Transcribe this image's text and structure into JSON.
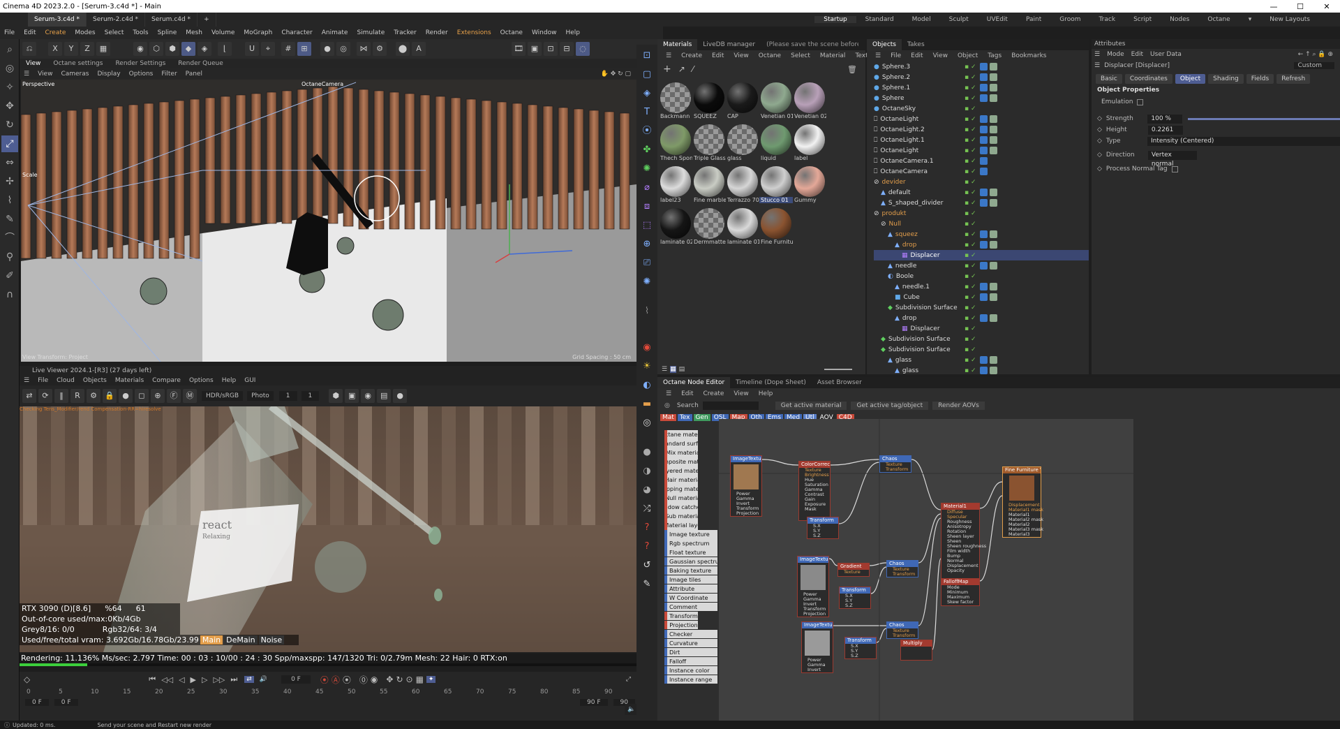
{
  "app": {
    "window_title": "Cinema 4D 2023.2.0 - [Serum-3.c4d *] - Main",
    "file_tabs": [
      "Serum-3.c4d *",
      "Serum-2.c4d *",
      "Serum.c4d *"
    ],
    "layouts": [
      "Startup",
      "Standard",
      "Model",
      "Sculpt",
      "UVEdit",
      "Paint",
      "Groom",
      "Track",
      "Script",
      "Nodes",
      "Octane"
    ],
    "new_layouts": "New Layouts"
  },
  "menu": [
    "File",
    "Edit",
    "Create",
    "Modes",
    "Select",
    "Tools",
    "Spline",
    "Mesh",
    "Volume",
    "MoGraph",
    "Character",
    "Animate",
    "Simulate",
    "Tracker",
    "Render",
    "Extensions",
    "Octane",
    "Window",
    "Help"
  ],
  "toolbar": {
    "axes": [
      "X",
      "Y",
      "Z"
    ]
  },
  "viewport": {
    "tabs": [
      "View",
      "Octane settings",
      "Render Settings",
      "Render Queue"
    ],
    "menu": [
      "View",
      "Cameras",
      "Display",
      "Options",
      "Filter",
      "Panel"
    ],
    "perspective": "Perspective",
    "camera": "OctaneCamera",
    "scale_label": "Scale",
    "view_transform": "View Transform: Project",
    "grid_spacing": "Grid Spacing : 50 cm"
  },
  "live_viewer": {
    "title": "Live Viewer 2024.1-[R3] (27 days left)",
    "menu": [
      "File",
      "Cloud",
      "Objects",
      "Materials",
      "Compare",
      "Options",
      "Help",
      "GUI"
    ],
    "color_space": "HDR/sRGB",
    "mode": "Photo",
    "val1": "1",
    "val2": "1",
    "overlay": "Checking Tens_Modifier/rend Compensation-RR=hiresolve",
    "label_text": "react",
    "label_sub": "Relaxing",
    "stats": {
      "gpu": "RTX 3090 (D)[8.6]",
      "pct": "%64",
      "temp": "61",
      "ooc": "Out-of-core used/max:0Kb/4Gb",
      "grey": "Grey8/16: 0/0",
      "rgb": "Rgb32/64: 3/4",
      "vram": "Used/free/total vram: 3.692Gb/16.78Gb/23.99",
      "tabs": [
        "Main",
        "DeMain",
        "Noise"
      ],
      "rendering": "Rendering: 11.136%  Ms/sec: 2.797  Time: 00 : 03 : 10/00 : 24 : 30  Spp/maxspp: 147/1320  Tri: 0/2.79m  Mesh: 22  Hair: 0  RTX:on"
    },
    "progress": 0.11
  },
  "timeline": {
    "frame_display": "0 F",
    "ticks": [
      "0",
      "5",
      "10",
      "15",
      "20",
      "25",
      "30",
      "35",
      "40",
      "45",
      "50",
      "55",
      "60",
      "65",
      "70",
      "75",
      "80",
      "85",
      "90"
    ],
    "start": "0 F",
    "start2": "0 F",
    "end": "90 F",
    "end2": "90",
    "slider_value": "10"
  },
  "status": {
    "updated": "Updated: 0 ms.",
    "message": "Send your scene and Restart new render"
  },
  "materials": {
    "tabs": [
      "Materials",
      "LiveDB manager"
    ],
    "notice": "(Please save the scene before downloading",
    "menu": [
      "Create",
      "Edit",
      "View",
      "Octane",
      "Select",
      "Material",
      "Texture"
    ],
    "items": [
      {
        "name": "Backmann",
        "color": "checker"
      },
      {
        "name": "SQUEEZ",
        "color": "#0b0b0b"
      },
      {
        "name": "CAP",
        "color": "#1a1a1a"
      },
      {
        "name": "Venetian 01",
        "color": "#8fa98f"
      },
      {
        "name": "Venetian 02",
        "color": "#b8a0b8"
      },
      {
        "name": "Thech Spon",
        "color": "#7f9a68"
      },
      {
        "name": "Triple Glass",
        "color": "checker"
      },
      {
        "name": "glass",
        "color": "checker"
      },
      {
        "name": "liquid",
        "color": "#6f9a70"
      },
      {
        "name": "label",
        "color": "#f2f2f2"
      },
      {
        "name": "label23",
        "color": "#dcdcdc"
      },
      {
        "name": "Fine marble",
        "color": "#c9ccc4"
      },
      {
        "name": "Terrazzo 70",
        "color": "#d6d6d6"
      },
      {
        "name": "Stucco 01",
        "color": "#cfcfcf"
      },
      {
        "name": "Gummy",
        "color": "#e4a898"
      },
      {
        "name": "laminate 02",
        "color": "#151515"
      },
      {
        "name": "Dermmatte",
        "color": "checker"
      },
      {
        "name": "laminate 01",
        "color": "#d9d9d9"
      },
      {
        "name": "Fine Furniture",
        "color": "#8a5330"
      }
    ],
    "selected": "Stucco 01"
  },
  "objects": {
    "tabs": [
      "Objects",
      "Takes"
    ],
    "menu": [
      "File",
      "Edit",
      "View",
      "Object",
      "Tags",
      "Bookmarks"
    ],
    "rows": [
      {
        "name": "Sphere.3",
        "depth": 0,
        "type": "sphere"
      },
      {
        "name": "Sphere.2",
        "depth": 0,
        "type": "sphere"
      },
      {
        "name": "Sphere.1",
        "depth": 0,
        "type": "sphere"
      },
      {
        "name": "Sphere",
        "depth": 0,
        "type": "sphere"
      },
      {
        "name": "OctaneSky",
        "depth": 0,
        "type": "sky"
      },
      {
        "name": "OctaneLight",
        "depth": 0,
        "type": "light"
      },
      {
        "name": "OctaneLight.2",
        "depth": 0,
        "type": "light"
      },
      {
        "name": "OctaneLight.1",
        "depth": 0,
        "type": "light"
      },
      {
        "name": "OctaneLight",
        "depth": 0,
        "type": "light"
      },
      {
        "name": "OctaneCamera.1",
        "depth": 0,
        "type": "camera"
      },
      {
        "name": "OctaneCamera",
        "depth": 0,
        "type": "camera"
      },
      {
        "name": "devider",
        "depth": 0,
        "type": "null",
        "orange": true
      },
      {
        "name": "default",
        "depth": 1,
        "type": "poly"
      },
      {
        "name": "S_shaped_divider",
        "depth": 1,
        "type": "poly"
      },
      {
        "name": "produkt",
        "depth": 0,
        "type": "null",
        "orange": true
      },
      {
        "name": "Null",
        "depth": 1,
        "type": "null",
        "orange": true
      },
      {
        "name": "squeez",
        "depth": 2,
        "type": "poly",
        "orange": true
      },
      {
        "name": "drop",
        "depth": 3,
        "type": "poly",
        "orange": true
      },
      {
        "name": "Displacer",
        "depth": 4,
        "type": "deformer",
        "selected": true
      },
      {
        "name": "needle",
        "depth": 2,
        "type": "poly"
      },
      {
        "name": "Boole",
        "depth": 2,
        "type": "boole"
      },
      {
        "name": "needle.1",
        "depth": 3,
        "type": "poly"
      },
      {
        "name": "Cube",
        "depth": 3,
        "type": "cube"
      },
      {
        "name": "Subdivision Surface",
        "depth": 2,
        "type": "subd"
      },
      {
        "name": "drop",
        "depth": 3,
        "type": "poly"
      },
      {
        "name": "Displacer",
        "depth": 4,
        "type": "deformer"
      },
      {
        "name": "Subdivision Surface",
        "depth": 1,
        "type": "subd"
      },
      {
        "name": "Subdivision Surface",
        "depth": 1,
        "type": "subd"
      },
      {
        "name": "glass",
        "depth": 2,
        "type": "poly"
      },
      {
        "name": "glass",
        "depth": 3,
        "type": "poly"
      }
    ]
  },
  "attributes": {
    "title": "Attributes",
    "menu": [
      "Mode",
      "Edit",
      "User Data"
    ],
    "object_name": "Displacer [Displacer]",
    "preset": "Custom",
    "tabs": [
      "Basic",
      "Coordinates",
      "Object",
      "Shading",
      "Fields",
      "Refresh"
    ],
    "section": "Object Properties",
    "fields": {
      "emulation": "Emulation",
      "strength_label": "Strength",
      "strength": "100 %",
      "height_label": "Height",
      "height": "0.2261 cm",
      "type_label": "Type",
      "type": "Intensity (Centered)",
      "direction_label": "Direction",
      "direction": "Vertex normal",
      "process_label": "Process Normal Tag"
    }
  },
  "node_editor": {
    "tabs": [
      "Octane Node Editor",
      "Timeline (Dope Sheet)",
      "Asset Browser"
    ],
    "menu": [
      "Edit",
      "Create",
      "View",
      "Help"
    ],
    "search": "Search",
    "buttons": [
      "Get active material",
      "Get active tag/object",
      "Render AOVs"
    ],
    "filters": [
      "Mat",
      "Tex",
      "Gen",
      "OSL",
      "Map",
      "Oth",
      "Ems",
      "Med",
      "Utl",
      "AOV",
      "C4D"
    ],
    "list": [
      {
        "label": "Octane material",
        "kind": "mat"
      },
      {
        "label": "Standard surface",
        "kind": "mat"
      },
      {
        "label": "Mix material",
        "kind": "mat"
      },
      {
        "label": "Composite material",
        "kind": "mat"
      },
      {
        "label": "Layered material",
        "kind": "mat"
      },
      {
        "label": "Hair material",
        "kind": "mat"
      },
      {
        "label": "Clipping material",
        "kind": "mat"
      },
      {
        "label": "Null material",
        "kind": "mat"
      },
      {
        "label": "Shadow catcher m",
        "kind": "mat"
      },
      {
        "label": "Sub material",
        "kind": "mat"
      },
      {
        "label": "Material layer",
        "kind": "mat"
      },
      {
        "label": "Image texture",
        "kind": "tex"
      },
      {
        "label": "Rgb spectrum",
        "kind": "tex"
      },
      {
        "label": "Float texture",
        "kind": "tex"
      },
      {
        "label": "Gaussian spectrum",
        "kind": "tex"
      },
      {
        "label": "Baking texture",
        "kind": "tex"
      },
      {
        "label": "Image tiles",
        "kind": "tex"
      },
      {
        "label": "Attribute",
        "kind": "tex"
      },
      {
        "label": "W Coordinate",
        "kind": "tex"
      },
      {
        "label": "Comment",
        "kind": "tex"
      },
      {
        "label": "Transform",
        "kind": "mat"
      },
      {
        "label": "Projection",
        "kind": "mat"
      },
      {
        "label": "Checker",
        "kind": "tex"
      },
      {
        "label": "Curvature",
        "kind": "tex"
      },
      {
        "label": "Dirt",
        "kind": "tex"
      },
      {
        "label": "Falloff",
        "kind": "tex"
      },
      {
        "label": "Instance color",
        "kind": "tex"
      },
      {
        "label": "Instance range",
        "kind": "tex"
      }
    ],
    "nodes": [
      {
        "id": "imgtex1",
        "title": "ImageTexture",
        "params": [
          "Power",
          "Gamma",
          "Invert",
          "Transform",
          "Projection"
        ],
        "thumb": "#a07850"
      },
      {
        "id": "colorcorr",
        "title": "ColorCorrectio",
        "params": [
          "Texture",
          "Brightness",
          "Hue",
          "Saturation",
          "Gamma",
          "Contrast",
          "Gain",
          "Exposure",
          "Mask"
        ]
      },
      {
        "id": "chaos1",
        "title": "Chaos",
        "params": [
          "Texture",
          "Transform"
        ]
      },
      {
        "id": "transform1",
        "title": "Transform",
        "params": [
          "S.X",
          "S.Y",
          "S.Z"
        ]
      },
      {
        "id": "imgtex2",
        "title": "ImageTexture",
        "params": [
          "Power",
          "Gamma",
          "Invert",
          "Transform",
          "Projection"
        ],
        "thumb": "#8a8a8a"
      },
      {
        "id": "gradient",
        "title": "Gradient",
        "params": [
          "Texture"
        ]
      },
      {
        "id": "chaos2",
        "title": "Chaos",
        "params": [
          "Texture",
          "Transform"
        ]
      },
      {
        "id": "transform2",
        "title": "Transform",
        "params": [
          "S.X",
          "S.Y",
          "S.Z"
        ]
      },
      {
        "id": "imgtex3",
        "title": "ImageTexture",
        "params": [
          "Power",
          "Gamma",
          "Invert"
        ],
        "thumb": "#9a9a9a"
      },
      {
        "id": "transform3",
        "title": "Transform",
        "params": [
          "S.X",
          "S.Y",
          "S.Z"
        ]
      },
      {
        "id": "chaos3",
        "title": "Chaos",
        "params": [
          "Texture",
          "Transform"
        ]
      },
      {
        "id": "multiply",
        "title": "Multiply",
        "params": []
      },
      {
        "id": "material1",
        "title": "Material1",
        "params": [
          "Diffuse",
          "Specular",
          "Roughness",
          "Anisotropy",
          "Rotation",
          "Sheen layer",
          "Sheen",
          "Sheen roughness",
          "Film width",
          "Bump",
          "Normal",
          "Displacement",
          "Opacity"
        ]
      },
      {
        "id": "falloffmap",
        "title": "FalloffMap",
        "params": [
          "Mode",
          "Minimum",
          "Maximum",
          "Skew factor"
        ]
      },
      {
        "id": "output",
        "title": "Fine Furniture Wi",
        "params": [
          "Displacement",
          "Material1 mask",
          "Material1",
          "Material2 mask",
          "Material2",
          "Material3 mask",
          "Material3"
        ],
        "thumb": "#8a5330"
      }
    ]
  },
  "colors": {
    "accent": "#4e5d92",
    "orange": "#e39e4b",
    "check": "#76c352",
    "red": "#c94a3a"
  }
}
